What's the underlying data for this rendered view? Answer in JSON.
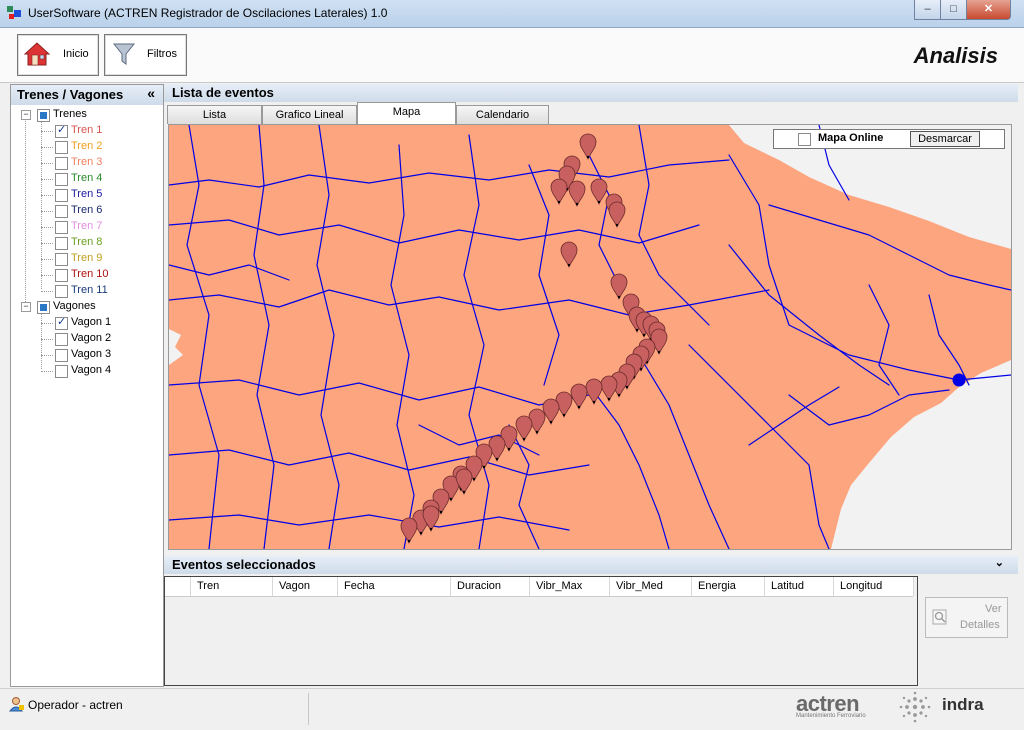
{
  "window": {
    "title": "UserSoftware (ACTREN Registrador de Oscilaciones Laterales) 1.0",
    "buttons": {
      "minimize": "–",
      "maximize": "□",
      "close": "✕"
    }
  },
  "toolbar": {
    "home_label": "Inicio",
    "filters_label": "Filtros",
    "heading": "Analisis"
  },
  "left_panel": {
    "title": "Trenes / Vagones",
    "collapse_glyph": "«",
    "groups": [
      {
        "label": "Trenes",
        "items": [
          {
            "label": "Tren 1",
            "checked": true,
            "color": "#d9534f"
          },
          {
            "label": "Tren 2",
            "checked": false,
            "color": "#f0a020"
          },
          {
            "label": "Tren 3",
            "checked": false,
            "color": "#f08060"
          },
          {
            "label": "Tren 4",
            "checked": false,
            "color": "#2a8a2a"
          },
          {
            "label": "Tren 5",
            "checked": false,
            "color": "#1a1aa0"
          },
          {
            "label": "Tren 6",
            "checked": false,
            "color": "#1a2a6a"
          },
          {
            "label": "Tren 7",
            "checked": false,
            "color": "#e090e0"
          },
          {
            "label": "Tren 8",
            "checked": false,
            "color": "#6aa020"
          },
          {
            "label": "Tren 9",
            "checked": false,
            "color": "#c0a020"
          },
          {
            "label": "Tren 10",
            "checked": false,
            "color": "#b01010"
          },
          {
            "label": "Tren 11",
            "checked": false,
            "color": "#1a3a7a"
          }
        ]
      },
      {
        "label": "Vagones",
        "items": [
          {
            "label": "Vagon 1",
            "checked": true,
            "color": "#000000"
          },
          {
            "label": "Vagon 2",
            "checked": false,
            "color": "#000000"
          },
          {
            "label": "Vagon 3",
            "checked": false,
            "color": "#000000"
          },
          {
            "label": "Vagon 4",
            "checked": false,
            "color": "#000000"
          }
        ]
      }
    ]
  },
  "events": {
    "title": "Lista de eventos",
    "tabs": [
      "Lista",
      "Grafico Lineal",
      "Mapa",
      "Calendario"
    ],
    "active_tab": "Mapa"
  },
  "map": {
    "online_label": "Mapa Online",
    "online_checked": false,
    "clear_button": "Desmarcar",
    "land_color": "#fca57f",
    "road_color": "#0000e6",
    "marker_color": "#c86060"
  },
  "selected": {
    "title": "Eventos seleccionados",
    "collapse_glyph": "⌄",
    "columns": [
      "Tren",
      "Vagon",
      "Fecha",
      "Duracion",
      "Vibr_Max",
      "Vibr_Med",
      "Energia",
      "Latitud",
      "Longitud"
    ],
    "details_button": [
      "Ver",
      "Detalles"
    ]
  },
  "status": {
    "user": "Operador - actren",
    "brand1": "actren",
    "brand1_sub": "Mantenimiento Ferroviario",
    "brand2": "indra"
  }
}
